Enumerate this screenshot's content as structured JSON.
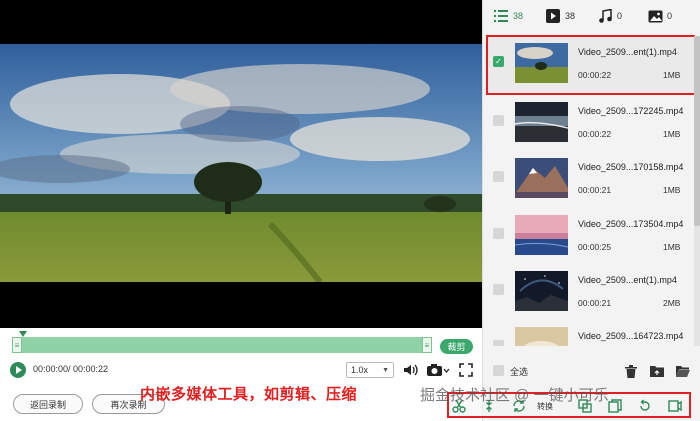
{
  "colors": {
    "accent": "#2e8b57",
    "highlight": "#e02020",
    "panel_bg": "#f3f3f3"
  },
  "tabs": [
    {
      "icon": "list-icon",
      "count": "38"
    },
    {
      "icon": "video-icon",
      "count": "38"
    },
    {
      "icon": "music-icon",
      "count": "0"
    },
    {
      "icon": "image-icon",
      "count": "0"
    }
  ],
  "player": {
    "cut_label": "裁剪",
    "time": "00:00:00/ 00:00:22",
    "speed": "1.0x",
    "back_label": "返回录制",
    "again_label": "再次录制"
  },
  "files": [
    {
      "name": "Video_2509...ent(1).mp4",
      "duration": "00:00:22",
      "size": "1MB",
      "checked": true
    },
    {
      "name": "Video_2509...172245.mp4",
      "duration": "00:00:22",
      "size": "1MB",
      "checked": false
    },
    {
      "name": "Video_2509...170158.mp4",
      "duration": "00:00:21",
      "size": "1MB",
      "checked": false
    },
    {
      "name": "Video_2509...173504.mp4",
      "duration": "00:00:25",
      "size": "1MB",
      "checked": false
    },
    {
      "name": "Video_2509...ent(1).mp4",
      "duration": "00:00:21",
      "size": "2MB",
      "checked": false
    },
    {
      "name": "Video_2509...164723.mp4",
      "duration": "",
      "size": "",
      "checked": false
    }
  ],
  "panel_footer": {
    "select_all_label": "全选"
  },
  "toolstrip": {
    "convert_label": "转换"
  },
  "overlay": {
    "caption": "内嵌多媒体工具，如剪辑、压缩",
    "watermark": "掘金技术社区 @ 一键小可乐"
  }
}
